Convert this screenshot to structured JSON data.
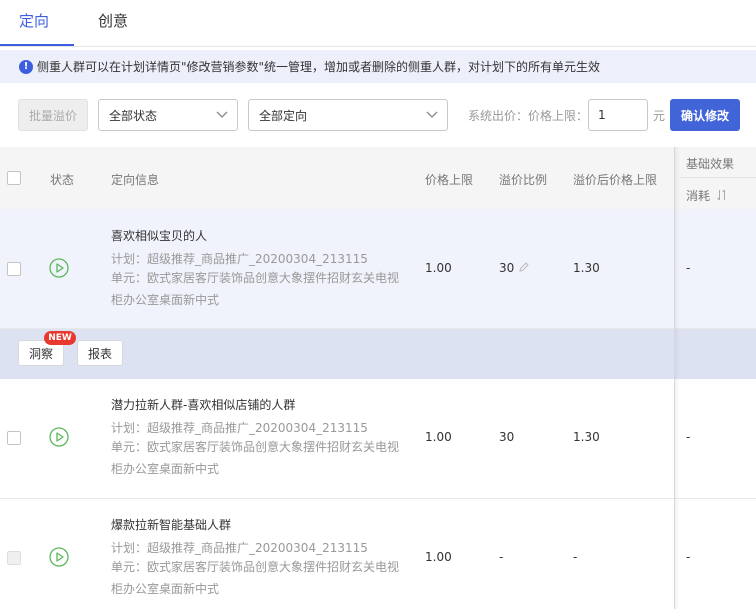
{
  "tabs": [
    {
      "label": "定向"
    },
    {
      "label": "创意"
    }
  ],
  "notice": {
    "text": "侧重人群可以在计划详情页\"修改营销参数\"统一管理，增加或者删除的侧重人群，对计划下的所有单元生效"
  },
  "toolbar": {
    "batch_premium_label": "批量溢价",
    "status_select": "全部状态",
    "targeting_select": "全部定向",
    "system_bid_label": "系统出价：价格上限：",
    "price_limit_value": "1",
    "unit_label": "元",
    "confirm_label": "确认修改"
  },
  "table": {
    "headers": {
      "status": "状态",
      "targeting": "定向信息",
      "price_limit": "价格上限",
      "premium_ratio": "溢价比例",
      "premium_price": "溢价后价格上限",
      "basic_effect": "基础效果",
      "cost": "消耗"
    },
    "rows": [
      {
        "name": "喜欢相似宝贝的人",
        "plan": "计划：超级推荐_商品推广_20200304_213115",
        "unit": "单元：欧式家居客厅装饰品创意大象摆件招财玄关电视柜办公室桌面新中式",
        "price_limit": "1.00",
        "premium_ratio": "30",
        "premium_price": "1.30",
        "cost": "-"
      },
      {
        "name": "潜力拉新人群-喜欢相似店铺的人群",
        "plan": "计划：超级推荐_商品推广_20200304_213115",
        "unit": "单元：欧式家居客厅装饰品创意大象摆件招财玄关电视柜办公室桌面新中式",
        "price_limit": "1.00",
        "premium_ratio": "30",
        "premium_price": "1.30",
        "cost": "-"
      },
      {
        "name": "爆款拉新智能基础人群",
        "plan": "计划：超级推荐_商品推广_20200304_213115",
        "unit": "单元：欧式家居客厅装饰品创意大象摆件招财玄关电视柜办公室桌面新中式",
        "price_limit": "1.00",
        "premium_ratio": "-",
        "premium_price": "-",
        "cost": "-"
      }
    ]
  },
  "action_bar": {
    "insight_label": "洞察",
    "new_badge": "NEW",
    "report_label": "报表"
  },
  "colors": {
    "accent": "#3e5ee0",
    "primary_button": "#4164d9",
    "play_icon": "#5bb85b",
    "new_badge": "#e8392f"
  }
}
